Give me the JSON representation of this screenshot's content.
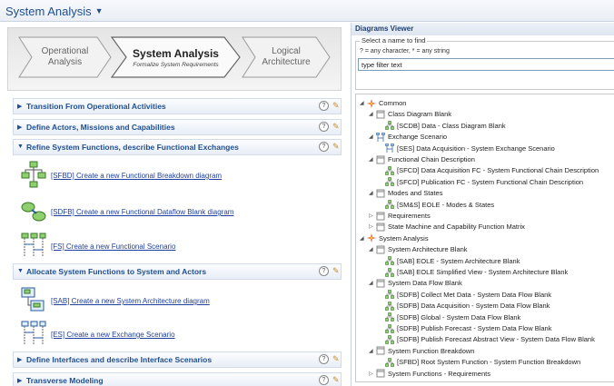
{
  "window": {
    "title": "System Analysis"
  },
  "phases": [
    {
      "label": "Operational Analysis"
    },
    {
      "label": "System Analysis",
      "subtitle": "Formalize System Requirements"
    },
    {
      "label": "Logical Architecture"
    }
  ],
  "sections": [
    {
      "label": "Transition From Operational Activities",
      "expanded": false
    },
    {
      "label": "Define Actors, Missions and Capabilities",
      "expanded": false
    },
    {
      "label": "Refine System Functions, describe Functional Exchanges",
      "expanded": true
    },
    {
      "label": "Allocate System Functions to System and  Actors",
      "expanded": true
    },
    {
      "label": "Define Interfaces and describe Interface Scenarios",
      "expanded": false
    },
    {
      "label": "Transverse Modeling",
      "expanded": false
    }
  ],
  "section_glyphs": {
    "collapsed": "▶",
    "expanded": "▼",
    "help": "?",
    "wand": "✎"
  },
  "entries": [
    {
      "label": "[SFBD] Create a new Functional Breakdown diagram"
    },
    {
      "label": "[SDFB] Create a new Functional Dataflow Blank diagram"
    },
    {
      "label": "[FS] Create a new Functional Scenario"
    },
    {
      "label": "[SAB] Create a new System Architecture diagram"
    },
    {
      "label": "[ES] Create a new Exchange Scenario"
    }
  ],
  "viewer": {
    "title": "Diagrams Viewer",
    "group_label": "Select a name to find",
    "hint": "? = any character, * = any string",
    "filter_value": "type filter text"
  },
  "tree": [
    {
      "label": "Common",
      "level": 0,
      "toggle": "◢",
      "icon": "capella"
    },
    {
      "label": "Class Diagram Blank",
      "level": 1,
      "toggle": "◢",
      "icon": "folder"
    },
    {
      "label": "[SCDB] Data - Class Diagram Blank",
      "level": 2,
      "toggle": "",
      "icon": "diagram"
    },
    {
      "label": "Exchange Scenario",
      "level": 1,
      "toggle": "◢",
      "icon": "scenario"
    },
    {
      "label": "[SES] Data Acquisition - System Exchange Scenario",
      "level": 2,
      "toggle": "",
      "icon": "scenario"
    },
    {
      "label": "Functional Chain Description",
      "level": 1,
      "toggle": "◢",
      "icon": "folder"
    },
    {
      "label": "[SFCD] Data Acquisition FC - System Functional Chain Description",
      "level": 2,
      "toggle": "",
      "icon": "diagram"
    },
    {
      "label": "[SFCD] Publication FC - System Functional Chain Description",
      "level": 2,
      "toggle": "",
      "icon": "diagram"
    },
    {
      "label": "Modes and States",
      "level": 1,
      "toggle": "◢",
      "icon": "folder"
    },
    {
      "label": "[SM&S] EOLE - Modes & States",
      "level": 2,
      "toggle": "",
      "icon": "diagram"
    },
    {
      "label": "Requirements",
      "level": 1,
      "toggle": "▷",
      "icon": "folder"
    },
    {
      "label": "State Machine and Capability Function Matrix",
      "level": 1,
      "toggle": "▷",
      "icon": "folder"
    },
    {
      "label": "System Analysis",
      "level": 0,
      "toggle": "◢",
      "icon": "capella"
    },
    {
      "label": "System Architecture Blank",
      "level": 1,
      "toggle": "◢",
      "icon": "folder"
    },
    {
      "label": "[SAB] EOLE - System Architecture Blank",
      "level": 2,
      "toggle": "",
      "icon": "diagram"
    },
    {
      "label": "[SAB] EOLE Simplified View - System Architecture Blank",
      "level": 2,
      "toggle": "",
      "icon": "diagram"
    },
    {
      "label": "System Data Flow Blank",
      "level": 1,
      "toggle": "◢",
      "icon": "folder"
    },
    {
      "label": "[SDFB] Collect Met Data - System Data Flow Blank",
      "level": 2,
      "toggle": "",
      "icon": "diagram"
    },
    {
      "label": "[SDFB] Data Acquisition - System Data Flow Blank",
      "level": 2,
      "toggle": "",
      "icon": "diagram"
    },
    {
      "label": "[SDFB] Global - System Data Flow Blank",
      "level": 2,
      "toggle": "",
      "icon": "diagram"
    },
    {
      "label": "[SDFB] Publish Forecast - System Data Flow Blank",
      "level": 2,
      "toggle": "",
      "icon": "diagram"
    },
    {
      "label": "[SDFB] Publish Forecast Abstract View - System Data Flow Blank",
      "level": 2,
      "toggle": "",
      "icon": "diagram"
    },
    {
      "label": "System Function Breakdown",
      "level": 1,
      "toggle": "◢",
      "icon": "folder"
    },
    {
      "label": "[SFBD] Root System Function - System Function Breakdown",
      "level": 2,
      "toggle": "",
      "icon": "diagram"
    },
    {
      "label": "System Functions - Requirements",
      "level": 1,
      "toggle": "▷",
      "icon": "folder"
    }
  ],
  "colors": {
    "accent": "#1f4f8f",
    "link": "#1f3f9f",
    "section_bg": "#e8eef7"
  }
}
